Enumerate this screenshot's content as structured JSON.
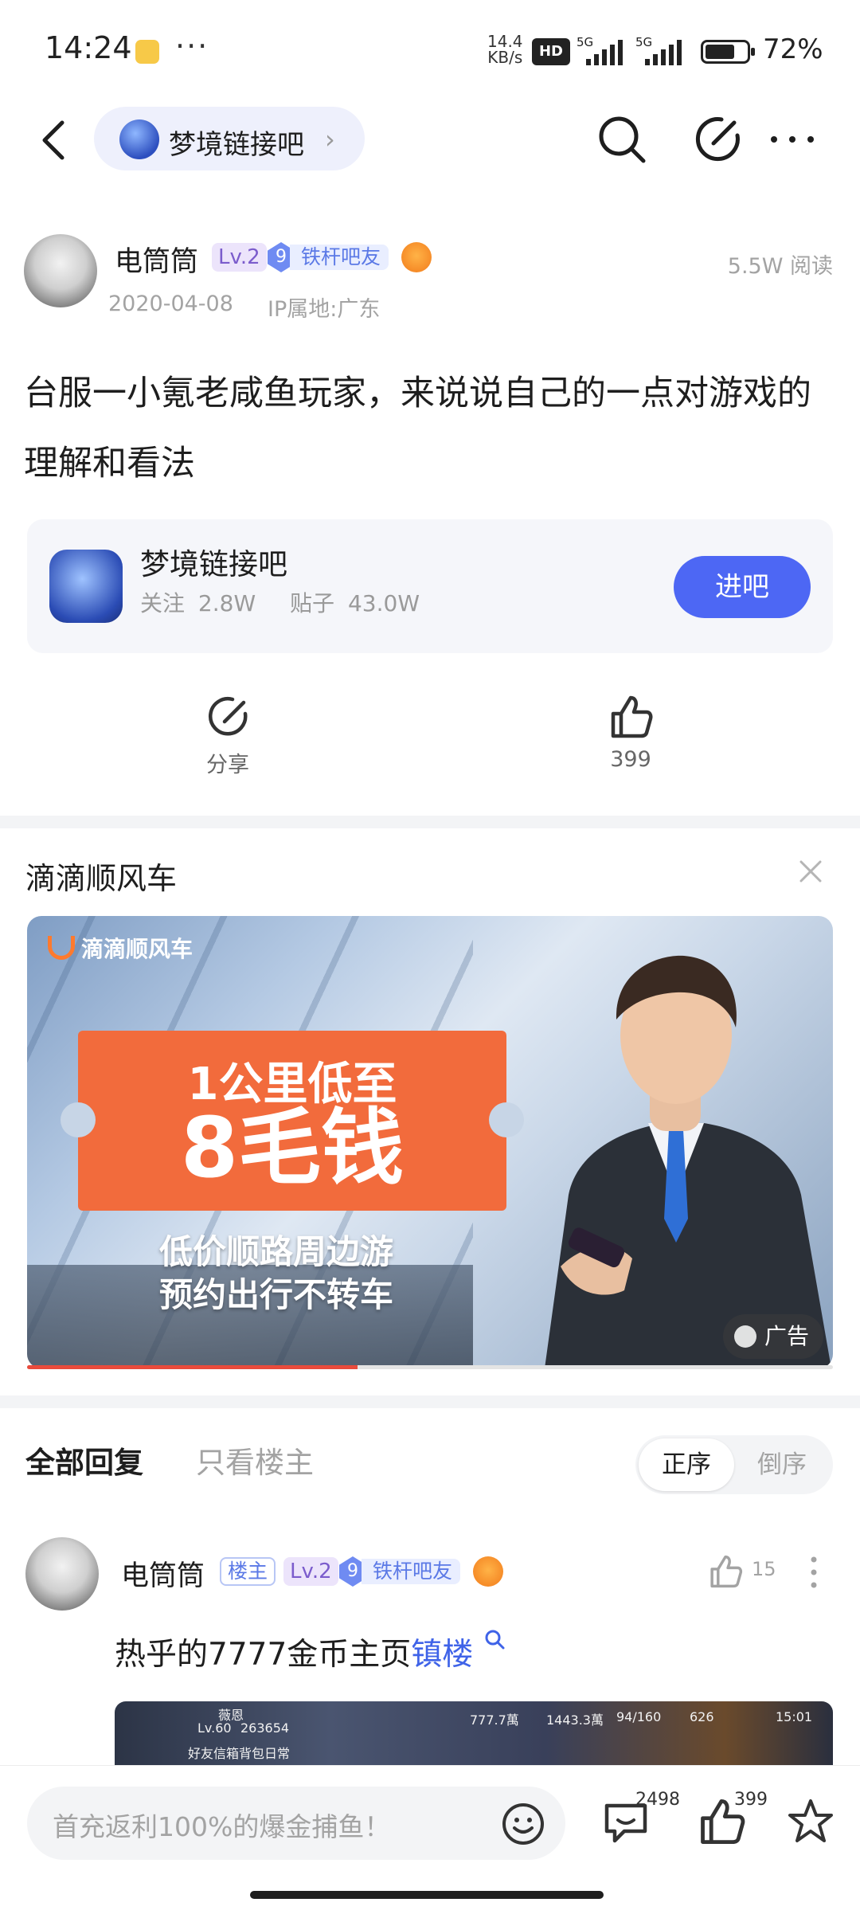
{
  "status_bar": {
    "time": "14:24",
    "net_speed_value": "14.4",
    "net_speed_unit": "KB/s",
    "hd": "HD",
    "signal_1": "5G",
    "signal_2": "5G",
    "battery_pct": "72%",
    "battery_level": 0.72
  },
  "header": {
    "forum_name": "梦境链接吧",
    "chevron": "›"
  },
  "post": {
    "author": "电筒筒",
    "level": "Lv.2",
    "fan_level": "9",
    "fan_title": "铁杆吧友",
    "views": "5.5W  阅读",
    "date": "2020-04-08",
    "ip": "IP属地:广东",
    "title": "台服一小氪老咸鱼玩家，来说说自己的一点对游戏的理解和看法"
  },
  "forum_card": {
    "name": "梦境链接吧",
    "follow_label": "关注",
    "follow_count": "2.8W",
    "posts_label": "贴子",
    "posts_count": "43.0W",
    "enter_label": "进吧"
  },
  "actions": {
    "share_label": "分享",
    "like_count": "399"
  },
  "ad": {
    "title": "滴滴顺风车",
    "brand": "滴滴顺风车",
    "headline_1": "1公里低至",
    "headline_2": "8毛钱",
    "sub_1": "低价顺路周边游",
    "sub_2": "预约出行不转车",
    "ad_label": "广告",
    "progress": 0.41
  },
  "replies": {
    "tab_all": "全部回复",
    "tab_owner": "只看楼主",
    "order_asc": "正序",
    "order_desc": "倒序"
  },
  "reply": {
    "author": "电筒筒",
    "owner_tag": "楼主",
    "level": "Lv.2",
    "fan_level": "9",
    "fan_title": "铁杆吧友",
    "likes": "15",
    "text": "热乎的7777金币主页",
    "link_text": "镇楼",
    "image_hud": {
      "name": "薇恩",
      "lv": "Lv.60",
      "id": "263654",
      "res_1": "777.7萬",
      "res_2": "1443.3萬",
      "res_3": "94/160",
      "res_4": "626",
      "clock": "15:01",
      "menu_1": "好友",
      "menu_2": "信箱",
      "menu_3": "背包",
      "menu_4": "日常"
    }
  },
  "bottom_bar": {
    "input_placeholder": "首充返利100%的爆金捕鱼！",
    "comment_count": "2498",
    "like_count": "399"
  }
}
